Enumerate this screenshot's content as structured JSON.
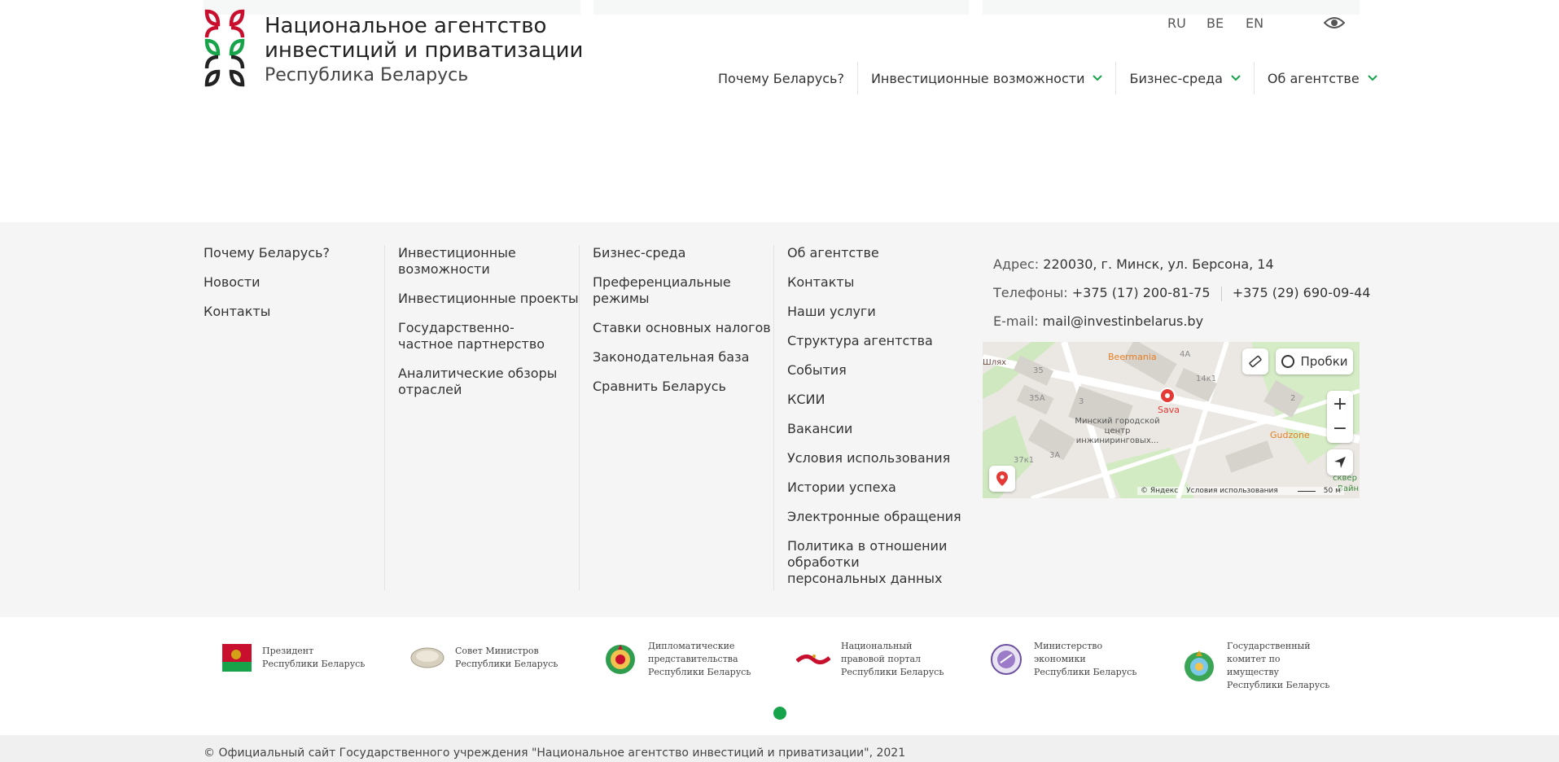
{
  "header": {
    "brand_line1": "Национальное агентство",
    "brand_line2": "инвестиций и приватизации",
    "brand_sub": "Республика Беларусь",
    "languages": [
      "RU",
      "BE",
      "EN"
    ],
    "nav": [
      {
        "label": "Почему Беларусь?",
        "has_dropdown": false
      },
      {
        "label": "Инвестиционные возможности",
        "has_dropdown": true
      },
      {
        "label": "Бизнес-среда",
        "has_dropdown": true
      },
      {
        "label": "Об агентстве",
        "has_dropdown": true
      }
    ]
  },
  "footer": {
    "col1": [
      "Почему Беларусь?",
      "Новости",
      "Контакты"
    ],
    "col2": [
      "Инвестиционные возможности",
      "Инвестиционные проекты",
      "Государственно-частное партнерство",
      "Аналитические обзоры отраслей"
    ],
    "col3": [
      "Бизнес-среда",
      "Преференциальные режимы",
      "Ставки основных налогов",
      "Законодательная база",
      "Сравнить Беларусь"
    ],
    "col4": [
      "Об агентстве",
      "Контакты",
      "Наши услуги",
      "Структура агентства",
      "События",
      "КСИИ",
      "Вакансии",
      "Условия использования",
      "Истории успеха",
      "Электронные обращения",
      "Политика в отношении обработки персональных данных"
    ],
    "contact": {
      "address_label": "Адрес:",
      "address": "220030, г. Минск, ул. Берсона, 14",
      "phone_label": "Телефоны:",
      "phone1": "+375 (17) 200-81-75",
      "phone2": "+375 (29) 690-09-44",
      "email_label": "E-mail:",
      "email": "mail@investinbelarus.by"
    },
    "map": {
      "traffic_label": "Пробки",
      "zoom_in": "+",
      "zoom_out": "−",
      "copyright": "© Яндекс",
      "terms": "Условия использования",
      "scale": "50 м",
      "labels": {
        "shlyah": "Шлях",
        "b35": "35",
        "b35a": "35А",
        "b3": "3",
        "b3a": "3А",
        "b37k1": "37к1",
        "b4a": "4А",
        "b14k1": "14к1",
        "b2": "2",
        "beermania": "Beermania",
        "sava": "Sava",
        "gudzone": "Gudzone",
        "center": "Минский городской центр инжиниринговых...",
        "skver": "сквер",
        "vayn": "Вайн"
      }
    }
  },
  "partners": [
    {
      "name": "Президент Республики Беларусь"
    },
    {
      "name": "Совет Министров Республики Беларусь"
    },
    {
      "name": "Дипломатические представительства Республики Беларусь"
    },
    {
      "name": "Национальный правовой портал Республики Беларусь"
    },
    {
      "name": "Министерство экономики Республики Беларусь"
    },
    {
      "name": "Государственный комитет по имуществу Республики Беларусь"
    }
  ],
  "copyright": "© Официальный сайт Государственного учреждения \"Национальное агентство инвестиций и приватизации\", 2021",
  "colors": {
    "accent": "#16a34a",
    "brand_red": "#c8102e",
    "brand_green": "#16a34a"
  }
}
